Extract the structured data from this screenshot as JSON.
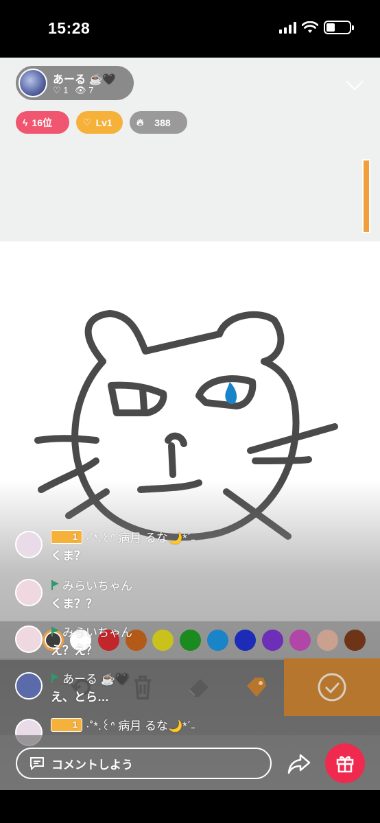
{
  "status_bar": {
    "time": "15:28"
  },
  "host": {
    "name": "あーる ☕️🖤",
    "likes": "1",
    "viewers": "7"
  },
  "badges": {
    "rank": "16位",
    "level": "Lv1",
    "points": "388"
  },
  "palette": {
    "colors": [
      "#3d3d3d",
      "#ffffff",
      "#c0262a",
      "#b45a18",
      "#c9c21d",
      "#1b8a1f",
      "#1a84c9",
      "#1c2bb8",
      "#6d2eb8",
      "#b246a8",
      "#c9a18e",
      "#6e3418"
    ],
    "selected_index": 0
  },
  "tools": {
    "icons": [
      "undo-icon",
      "trash-icon",
      "eraser-icon",
      "tag-icon",
      "check-icon"
    ]
  },
  "chat": [
    {
      "name": "·˚*.꒰ᐢ 病月 るな🌙*ˊ˗",
      "text": "くま？",
      "level": "1",
      "avatar_color": "#e9dbe8"
    },
    {
      "name": "みらいちゃん",
      "text": "くま？？",
      "level": "",
      "avatar_color": "#f0d8e0"
    },
    {
      "name": "みらいちゃん",
      "text": "え？え？",
      "level": "",
      "avatar_color": "#f0d8e0"
    },
    {
      "name": "あーる ☕️🖤",
      "text": "え、とら…",
      "level": "",
      "avatar_color": "#5b6aa8"
    },
    {
      "name": "·˚*.꒰ᐢ 病月 るな🌙*ˊ˗",
      "text": "",
      "level": "1",
      "avatar_color": "#e9dbe8"
    }
  ],
  "comment": {
    "placeholder": "コメントしよう"
  }
}
